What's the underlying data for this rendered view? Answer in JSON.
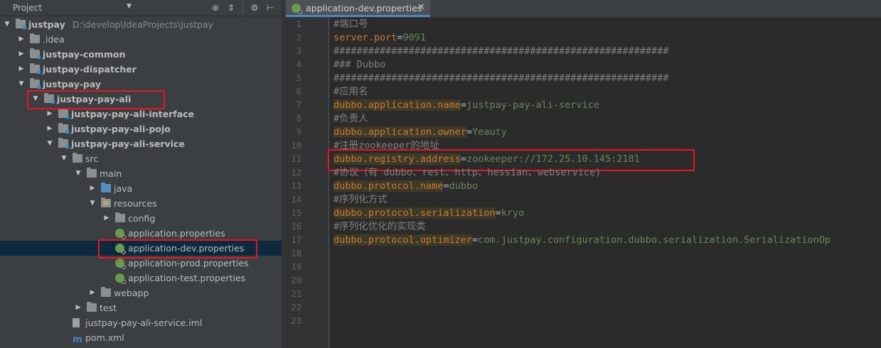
{
  "project_panel": {
    "title": "Project",
    "tree": [
      {
        "label": "justpay",
        "path": "D:\\develop\\IdeaProjects\\justpay",
        "indent": 0,
        "expanded": true,
        "icon": "module-folder-icon",
        "bold": true
      },
      {
        "label": ".idea",
        "indent": 1,
        "expanded": false,
        "icon": "folder-icon",
        "bold": false
      },
      {
        "label": "justpay-common",
        "indent": 1,
        "expanded": false,
        "icon": "module-folder-icon",
        "bold": true
      },
      {
        "label": "justpay-dispatcher",
        "indent": 1,
        "expanded": false,
        "icon": "module-folder-icon",
        "bold": true
      },
      {
        "label": "justpay-pay",
        "indent": 1,
        "expanded": true,
        "icon": "module-folder-icon",
        "bold": true
      },
      {
        "label": "justpay-pay-ali",
        "indent": 2,
        "expanded": true,
        "icon": "module-folder-icon",
        "bold": true,
        "highlight": true
      },
      {
        "label": "justpay-pay-ali-interface",
        "indent": 3,
        "expanded": false,
        "icon": "module-folder-icon",
        "bold": true
      },
      {
        "label": "justpay-pay-ali-pojo",
        "indent": 3,
        "expanded": false,
        "icon": "module-folder-icon",
        "bold": true
      },
      {
        "label": "justpay-pay-ali-service",
        "indent": 3,
        "expanded": true,
        "icon": "module-folder-icon",
        "bold": true
      },
      {
        "label": "src",
        "indent": 4,
        "expanded": true,
        "icon": "folder-icon",
        "bold": false
      },
      {
        "label": "main",
        "indent": 5,
        "expanded": true,
        "icon": "folder-icon",
        "bold": false
      },
      {
        "label": "java",
        "indent": 6,
        "expanded": false,
        "icon": "source-folder-icon",
        "bold": false
      },
      {
        "label": "resources",
        "indent": 6,
        "expanded": true,
        "icon": "resources-folder-icon",
        "bold": false
      },
      {
        "label": "config",
        "indent": 7,
        "expanded": false,
        "icon": "folder-icon",
        "bold": false
      },
      {
        "label": "application.properties",
        "indent": 7,
        "leaf": true,
        "icon": "spring-properties-icon",
        "bold": false
      },
      {
        "label": "application-dev.properties",
        "indent": 7,
        "leaf": true,
        "icon": "spring-properties-icon",
        "bold": false,
        "selected": true,
        "highlight": true
      },
      {
        "label": "application-prod.properties",
        "indent": 7,
        "leaf": true,
        "icon": "spring-properties-icon",
        "bold": false
      },
      {
        "label": "application-test.properties",
        "indent": 7,
        "leaf": true,
        "icon": "spring-properties-icon",
        "bold": false
      },
      {
        "label": "webapp",
        "indent": 6,
        "expanded": false,
        "icon": "folder-icon",
        "bold": false
      },
      {
        "label": "test",
        "indent": 5,
        "expanded": false,
        "icon": "folder-icon",
        "bold": false
      },
      {
        "label": "justpay-pay-ali-service.iml",
        "indent": 4,
        "leaf": true,
        "icon": "iml-file-icon",
        "bold": false
      },
      {
        "label": "pom.xml",
        "indent": 4,
        "leaf": true,
        "icon": "maven-icon",
        "bold": false
      }
    ]
  },
  "editor": {
    "tab_label": "application-dev.properties",
    "close_glyph": "✕",
    "lines": [
      {
        "n": "1",
        "comment": "#端口号"
      },
      {
        "n": "2",
        "key": "server.port",
        "value": "9091",
        "plain_key": true
      },
      {
        "n": "3",
        "comment": "##########################################################"
      },
      {
        "n": "4",
        "comment": "### Dubbo"
      },
      {
        "n": "5",
        "comment": "##########################################################"
      },
      {
        "n": "6",
        "comment": "#应用名"
      },
      {
        "n": "7",
        "key": "dubbo.application.name",
        "value": "justpay-pay-ali-service"
      },
      {
        "n": "8",
        "comment": "#负责人"
      },
      {
        "n": "9",
        "key": "dubbo.application.owner",
        "value": "Yeauty"
      },
      {
        "n": "10",
        "comment": "#注册zookeeper的地址"
      },
      {
        "n": "11",
        "key": "dubbo.registry.address",
        "value": "zookeeper://172.25.10.145:2181",
        "highlight": true
      },
      {
        "n": "12",
        "comment": "#协议（有 dubbo、rest、http、hessian、webservice)"
      },
      {
        "n": "13",
        "key": "dubbo.protocol.name",
        "value": "dubbo"
      },
      {
        "n": "14",
        "comment": "#序列化方式"
      },
      {
        "n": "15",
        "key": "dubbo.protocol.serialization",
        "value": "kryo"
      },
      {
        "n": "16",
        "comment": "#序列化优化的实现类"
      },
      {
        "n": "17",
        "key": "dubbo.protocol.optimizer",
        "value": "com.justpay.configuration.dubbo.serialization.SerializationOp"
      },
      {
        "n": "18"
      },
      {
        "n": "19"
      },
      {
        "n": "20"
      },
      {
        "n": "21"
      },
      {
        "n": "22"
      },
      {
        "n": "23"
      }
    ]
  }
}
